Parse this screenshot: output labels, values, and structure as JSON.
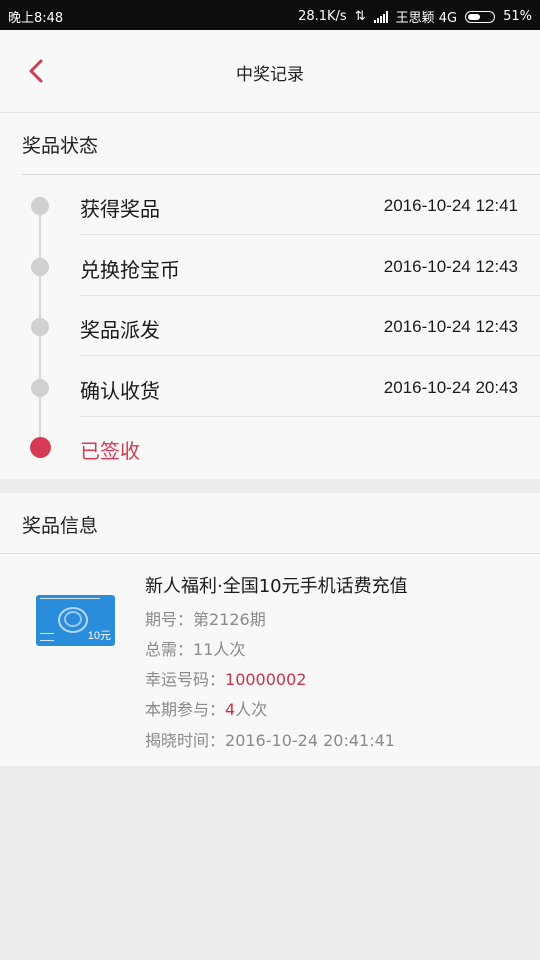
{
  "status_bar": {
    "time": "晚上8:48",
    "network_speed": "28.1K/s",
    "carrier": "王思颖 4G",
    "battery_percent": "51%",
    "battery_level": 0.51
  },
  "header": {
    "title": "中奖记录",
    "back_icon": "chevron-left-icon"
  },
  "status_section": {
    "title": "奖品状态",
    "steps": [
      {
        "label": "获得奖品",
        "time": "2016-10-24 12:41",
        "active": false
      },
      {
        "label": "兑换抢宝币",
        "time": "2016-10-24 12:43",
        "active": false
      },
      {
        "label": "奖品派发",
        "time": "2016-10-24 12:43",
        "active": false
      },
      {
        "label": "确认收货",
        "time": "2016-10-24 20:43",
        "active": false
      },
      {
        "label": "已签收",
        "time": "",
        "active": true
      }
    ]
  },
  "prize_section": {
    "title": "奖品信息",
    "card_value": "10元",
    "name": "新人福利·全国10元手机话费充值",
    "issue_label": "期号：",
    "issue_value": "第2126期",
    "total_label": "总需：",
    "total_value": "11人次",
    "lucky_label": "幸运号码：",
    "lucky_value": "10000002",
    "participate_label": "本期参与：",
    "participate_value": "4",
    "participate_unit": "人次",
    "reveal_label": "揭晓时间：",
    "reveal_value": "2016-10-24 20:41:41"
  },
  "colors": {
    "accent": "#d63a55",
    "highlight_red": "#c8324c",
    "card_blue": "#2a8ddc"
  }
}
